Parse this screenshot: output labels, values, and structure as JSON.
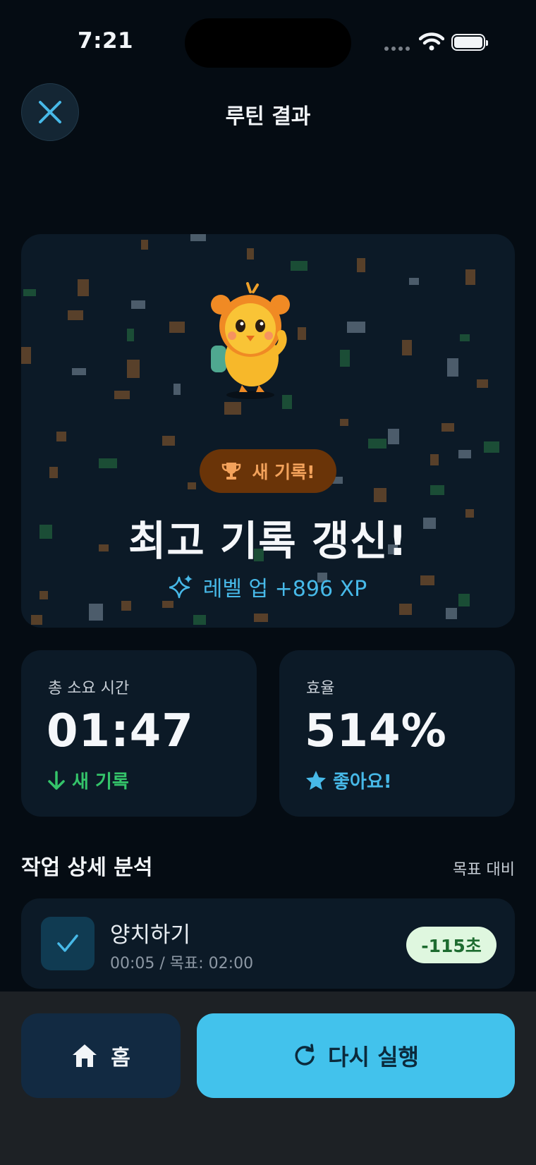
{
  "status": {
    "time": "7:21"
  },
  "header": {
    "title": "루틴 결과",
    "close_icon": "close-icon"
  },
  "hero": {
    "badge_label": "새 기록!",
    "badge_icon": "trophy-icon",
    "title": "최고 기록 갱신!",
    "levelup_text": "레벨 업 +896 XP",
    "levelup_icon": "sparkles-icon",
    "mascot_icon": "chick-mascot-icon"
  },
  "stats": {
    "total_time": {
      "label": "총 소요 시간",
      "value": "01:47",
      "sub": "새 기록",
      "icon": "arrow-down-icon",
      "color": "#34c46a"
    },
    "efficiency": {
      "label": "효율",
      "value": "514%",
      "sub": "좋아요!",
      "icon": "star-icon",
      "color": "#47b9e8"
    }
  },
  "analysis": {
    "title": "작업 상세 분석",
    "aside": "목표 대비",
    "tasks": [
      {
        "name": "양치하기",
        "time": "00:05 / 목표: 02:00",
        "delta": "-115초",
        "checked": true
      }
    ]
  },
  "actions": {
    "home_label": "홈",
    "retry_label": "다시 실행"
  },
  "colors": {
    "background": "#050c13",
    "card": "#0c1a27",
    "accent": "#42c2ec",
    "badge": "#6a3408",
    "badge_text": "#f3a25b"
  }
}
